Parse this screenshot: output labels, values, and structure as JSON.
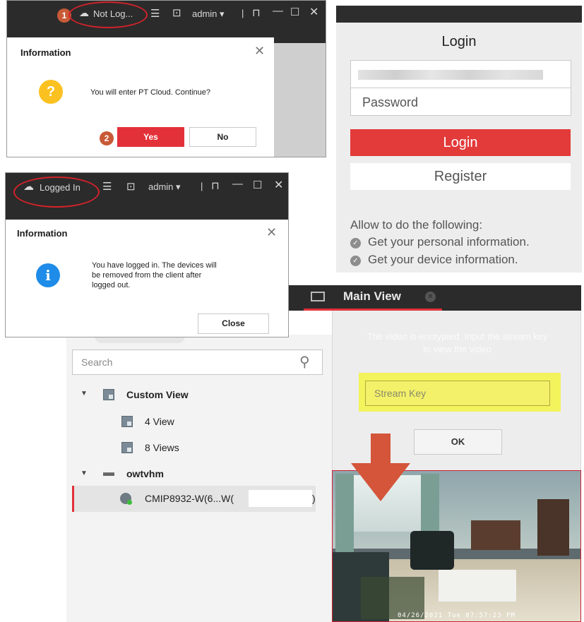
{
  "panel1": {
    "toolbar": {
      "status": "Not Log...",
      "user": "admin"
    },
    "step": "1",
    "dialog": {
      "title": "Information",
      "message": "You will enter PT Cloud. Continue?",
      "yes": "Yes",
      "no": "No",
      "step": "2"
    },
    "icons": {
      "status": "cloud-icon",
      "menu": "list-icon",
      "pulse": "activity-icon",
      "lock": "lock-icon",
      "minimize": "minimize-icon",
      "maximize": "maximize-icon",
      "close": "close-icon"
    }
  },
  "panel2": {
    "toolbar": {
      "status": "Logged In",
      "user": "admin"
    },
    "dialog": {
      "title": "Information",
      "message_lines": [
        "You have logged in. The devices will",
        "be removed from the client after",
        "logged out."
      ],
      "close": "Close"
    }
  },
  "login": {
    "title": "Login",
    "password_placeholder": "Password",
    "login_button": "Login",
    "register_button": "Register",
    "allow_heading": "Allow to do the following:",
    "permissions": [
      "Get your personal information.",
      "Get your device information."
    ]
  },
  "client": {
    "tab": "Main View",
    "search_placeholder": "Search",
    "tree": {
      "custom_view": "Custom View",
      "views": [
        "4 View",
        "8 Views"
      ],
      "group": "owtvhm",
      "device": "CMIP8932-W(6...W(",
      "device_suffix": ")"
    },
    "video": {
      "encrypted_msg_lines": [
        "The video is encrypted. Input the stream key",
        "to view the video"
      ],
      "stream_key_placeholder": "Stream Key",
      "ok": "OK",
      "timestamp": "04/26/2021 Tue 07:57:23 PM"
    }
  },
  "colors": {
    "brand_red": "#e3313a",
    "highlight_yellow": "#f4f42c",
    "arrow_orange": "#d4553a",
    "ellipse_red": "#d3222a",
    "step_orange": "#c85a37"
  }
}
